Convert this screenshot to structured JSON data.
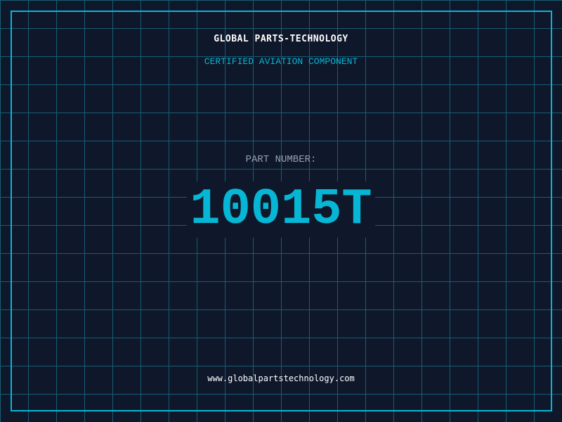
{
  "colors": {
    "background": "#0f172a",
    "grid": "#155e75",
    "accent": "#06b6d4",
    "label": "#94a3b8",
    "text": "#ffffff"
  },
  "header": {
    "title": "GLOBAL PARTS-TECHNOLOGY",
    "subtitle": "CERTIFIED AVIATION COMPONENT"
  },
  "part": {
    "label": "PART NUMBER:",
    "number": "10015T"
  },
  "footer": {
    "url": "www.globalpartstechnology.com"
  }
}
